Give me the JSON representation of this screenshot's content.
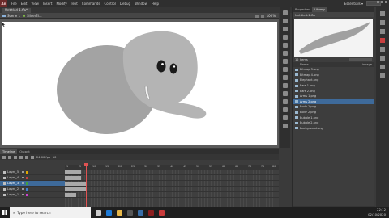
{
  "menubar": {
    "logo": "An",
    "items": [
      "File",
      "Edit",
      "View",
      "Insert",
      "Modify",
      "Text",
      "Commands",
      "Control",
      "Debug",
      "Window",
      "Help"
    ],
    "workspace": "Essentials ▾"
  },
  "document_tab": "Untitled-1.fla*",
  "breadcrumb": {
    "scene": "Scene 1",
    "symbol": "SilverEl...",
    "zoom": "100%"
  },
  "library": {
    "tabs": [
      "Properties",
      "Library"
    ],
    "file": "Untitled-1.fla",
    "count": "12 Items",
    "header_name": "Name",
    "header_linkage": "Linkage",
    "items": [
      "Bitmap 3.png",
      "Bitmap 4.png",
      "Elephant.png",
      "Ears 1.png",
      "Ears 2.png",
      "Arms 1.png",
      "Arms 2.png",
      "Body 1.png",
      "Body 2.png",
      "Bubble 1.png",
      "Bubble 2.png",
      "Background.png"
    ],
    "selected_index": 6
  },
  "timeline": {
    "tabs": [
      "Timeline",
      "Output"
    ],
    "fps": "24.00 fps",
    "current_frame": "10",
    "ruler": [
      "1",
      "5",
      "10",
      "15",
      "20",
      "25",
      "30",
      "35",
      "40",
      "45",
      "50",
      "55",
      "60",
      "65",
      "70",
      "75",
      "80"
    ],
    "layers": [
      {
        "name": "Layer_5",
        "color": "#e0a800"
      },
      {
        "name": "Layer_4",
        "color": "#c04040"
      },
      {
        "name": "Layer_3",
        "color": "#40a040"
      },
      {
        "name": "Layer_2",
        "color": "#4080d0"
      },
      {
        "name": "Layer_1",
        "color": "#d040d0"
      }
    ],
    "selected_layer": 2
  },
  "taskbar": {
    "search_placeholder": "Type here to search",
    "time": "22:12",
    "date": "02/10/2020"
  },
  "colors": {
    "accent": "#3e6a9a",
    "playhead": "#e05252",
    "elephant_body": "#a3a3a3",
    "elephant_head": "#b4b4b4"
  }
}
